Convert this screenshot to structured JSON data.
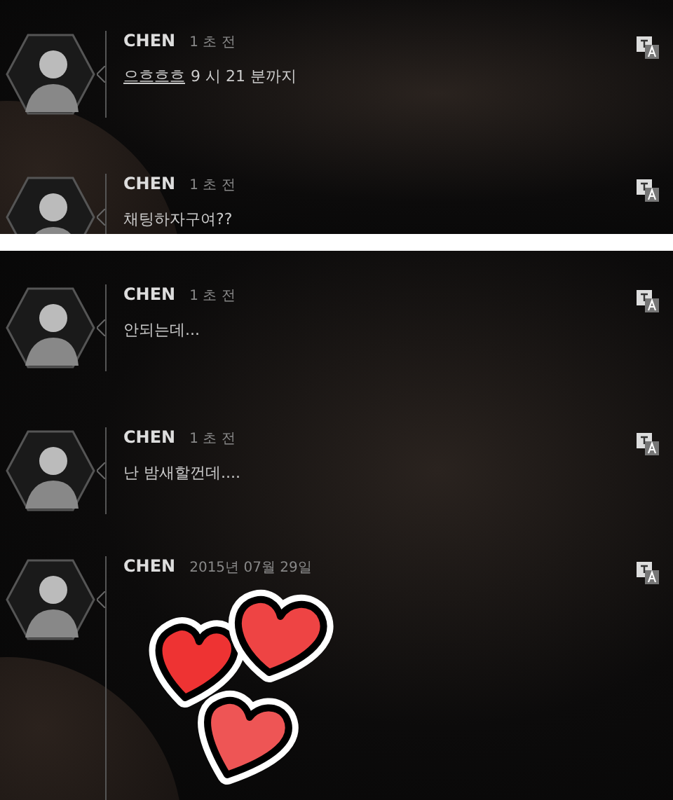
{
  "panels": [
    {
      "messages": [
        {
          "kind": "text",
          "name": "CHEN",
          "time": "1 초 전",
          "link": "으흐흐흐",
          "text": "9 시 21 분까지"
        },
        {
          "kind": "text",
          "name": "CHEN",
          "time": "1 초 전",
          "text": "채팅하자구여??"
        }
      ]
    },
    {
      "messages": [
        {
          "kind": "text",
          "name": "CHEN",
          "time": "1 초 전",
          "text": "안되는데..."
        },
        {
          "kind": "text",
          "name": "CHEN",
          "time": "1 초 전",
          "text": "난 밤새할껀데...."
        },
        {
          "kind": "sticker",
          "name": "CHEN",
          "time": "2015년 07월 29일"
        }
      ]
    }
  ]
}
